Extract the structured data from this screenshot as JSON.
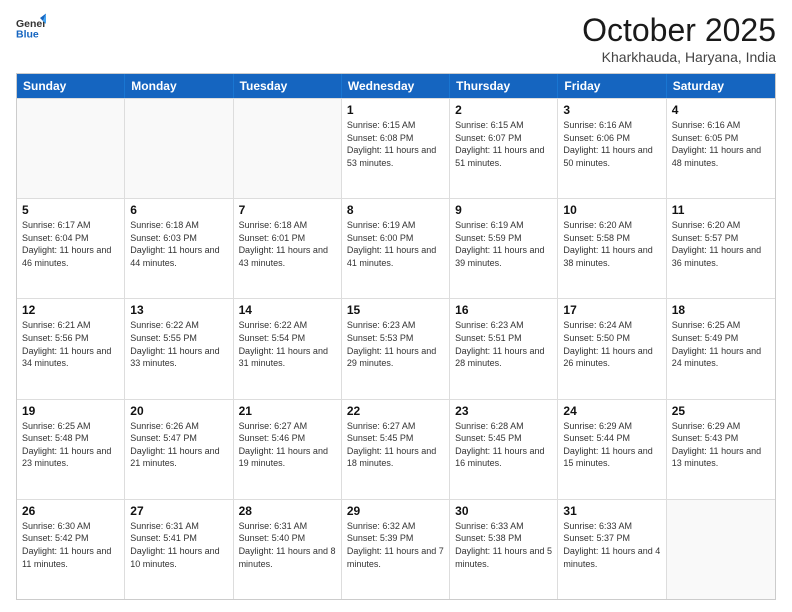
{
  "header": {
    "logo_general": "General",
    "logo_blue": "Blue",
    "month_title": "October 2025",
    "location": "Kharkhauda, Haryana, India"
  },
  "weekdays": [
    "Sunday",
    "Monday",
    "Tuesday",
    "Wednesday",
    "Thursday",
    "Friday",
    "Saturday"
  ],
  "weeks": [
    [
      {
        "day": "",
        "sunrise": "",
        "sunset": "",
        "daylight": "",
        "empty": true
      },
      {
        "day": "",
        "sunrise": "",
        "sunset": "",
        "daylight": "",
        "empty": true
      },
      {
        "day": "",
        "sunrise": "",
        "sunset": "",
        "daylight": "",
        "empty": true
      },
      {
        "day": "1",
        "sunrise": "Sunrise: 6:15 AM",
        "sunset": "Sunset: 6:08 PM",
        "daylight": "Daylight: 11 hours and 53 minutes."
      },
      {
        "day": "2",
        "sunrise": "Sunrise: 6:15 AM",
        "sunset": "Sunset: 6:07 PM",
        "daylight": "Daylight: 11 hours and 51 minutes."
      },
      {
        "day": "3",
        "sunrise": "Sunrise: 6:16 AM",
        "sunset": "Sunset: 6:06 PM",
        "daylight": "Daylight: 11 hours and 50 minutes."
      },
      {
        "day": "4",
        "sunrise": "Sunrise: 6:16 AM",
        "sunset": "Sunset: 6:05 PM",
        "daylight": "Daylight: 11 hours and 48 minutes."
      }
    ],
    [
      {
        "day": "5",
        "sunrise": "Sunrise: 6:17 AM",
        "sunset": "Sunset: 6:04 PM",
        "daylight": "Daylight: 11 hours and 46 minutes."
      },
      {
        "day": "6",
        "sunrise": "Sunrise: 6:18 AM",
        "sunset": "Sunset: 6:03 PM",
        "daylight": "Daylight: 11 hours and 44 minutes."
      },
      {
        "day": "7",
        "sunrise": "Sunrise: 6:18 AM",
        "sunset": "Sunset: 6:01 PM",
        "daylight": "Daylight: 11 hours and 43 minutes."
      },
      {
        "day": "8",
        "sunrise": "Sunrise: 6:19 AM",
        "sunset": "Sunset: 6:00 PM",
        "daylight": "Daylight: 11 hours and 41 minutes."
      },
      {
        "day": "9",
        "sunrise": "Sunrise: 6:19 AM",
        "sunset": "Sunset: 5:59 PM",
        "daylight": "Daylight: 11 hours and 39 minutes."
      },
      {
        "day": "10",
        "sunrise": "Sunrise: 6:20 AM",
        "sunset": "Sunset: 5:58 PM",
        "daylight": "Daylight: 11 hours and 38 minutes."
      },
      {
        "day": "11",
        "sunrise": "Sunrise: 6:20 AM",
        "sunset": "Sunset: 5:57 PM",
        "daylight": "Daylight: 11 hours and 36 minutes."
      }
    ],
    [
      {
        "day": "12",
        "sunrise": "Sunrise: 6:21 AM",
        "sunset": "Sunset: 5:56 PM",
        "daylight": "Daylight: 11 hours and 34 minutes."
      },
      {
        "day": "13",
        "sunrise": "Sunrise: 6:22 AM",
        "sunset": "Sunset: 5:55 PM",
        "daylight": "Daylight: 11 hours and 33 minutes."
      },
      {
        "day": "14",
        "sunrise": "Sunrise: 6:22 AM",
        "sunset": "Sunset: 5:54 PM",
        "daylight": "Daylight: 11 hours and 31 minutes."
      },
      {
        "day": "15",
        "sunrise": "Sunrise: 6:23 AM",
        "sunset": "Sunset: 5:53 PM",
        "daylight": "Daylight: 11 hours and 29 minutes."
      },
      {
        "day": "16",
        "sunrise": "Sunrise: 6:23 AM",
        "sunset": "Sunset: 5:51 PM",
        "daylight": "Daylight: 11 hours and 28 minutes."
      },
      {
        "day": "17",
        "sunrise": "Sunrise: 6:24 AM",
        "sunset": "Sunset: 5:50 PM",
        "daylight": "Daylight: 11 hours and 26 minutes."
      },
      {
        "day": "18",
        "sunrise": "Sunrise: 6:25 AM",
        "sunset": "Sunset: 5:49 PM",
        "daylight": "Daylight: 11 hours and 24 minutes."
      }
    ],
    [
      {
        "day": "19",
        "sunrise": "Sunrise: 6:25 AM",
        "sunset": "Sunset: 5:48 PM",
        "daylight": "Daylight: 11 hours and 23 minutes."
      },
      {
        "day": "20",
        "sunrise": "Sunrise: 6:26 AM",
        "sunset": "Sunset: 5:47 PM",
        "daylight": "Daylight: 11 hours and 21 minutes."
      },
      {
        "day": "21",
        "sunrise": "Sunrise: 6:27 AM",
        "sunset": "Sunset: 5:46 PM",
        "daylight": "Daylight: 11 hours and 19 minutes."
      },
      {
        "day": "22",
        "sunrise": "Sunrise: 6:27 AM",
        "sunset": "Sunset: 5:45 PM",
        "daylight": "Daylight: 11 hours and 18 minutes."
      },
      {
        "day": "23",
        "sunrise": "Sunrise: 6:28 AM",
        "sunset": "Sunset: 5:45 PM",
        "daylight": "Daylight: 11 hours and 16 minutes."
      },
      {
        "day": "24",
        "sunrise": "Sunrise: 6:29 AM",
        "sunset": "Sunset: 5:44 PM",
        "daylight": "Daylight: 11 hours and 15 minutes."
      },
      {
        "day": "25",
        "sunrise": "Sunrise: 6:29 AM",
        "sunset": "Sunset: 5:43 PM",
        "daylight": "Daylight: 11 hours and 13 minutes."
      }
    ],
    [
      {
        "day": "26",
        "sunrise": "Sunrise: 6:30 AM",
        "sunset": "Sunset: 5:42 PM",
        "daylight": "Daylight: 11 hours and 11 minutes."
      },
      {
        "day": "27",
        "sunrise": "Sunrise: 6:31 AM",
        "sunset": "Sunset: 5:41 PM",
        "daylight": "Daylight: 11 hours and 10 minutes."
      },
      {
        "day": "28",
        "sunrise": "Sunrise: 6:31 AM",
        "sunset": "Sunset: 5:40 PM",
        "daylight": "Daylight: 11 hours and 8 minutes."
      },
      {
        "day": "29",
        "sunrise": "Sunrise: 6:32 AM",
        "sunset": "Sunset: 5:39 PM",
        "daylight": "Daylight: 11 hours and 7 minutes."
      },
      {
        "day": "30",
        "sunrise": "Sunrise: 6:33 AM",
        "sunset": "Sunset: 5:38 PM",
        "daylight": "Daylight: 11 hours and 5 minutes."
      },
      {
        "day": "31",
        "sunrise": "Sunrise: 6:33 AM",
        "sunset": "Sunset: 5:37 PM",
        "daylight": "Daylight: 11 hours and 4 minutes."
      },
      {
        "day": "",
        "sunrise": "",
        "sunset": "",
        "daylight": "",
        "empty": true
      }
    ]
  ]
}
